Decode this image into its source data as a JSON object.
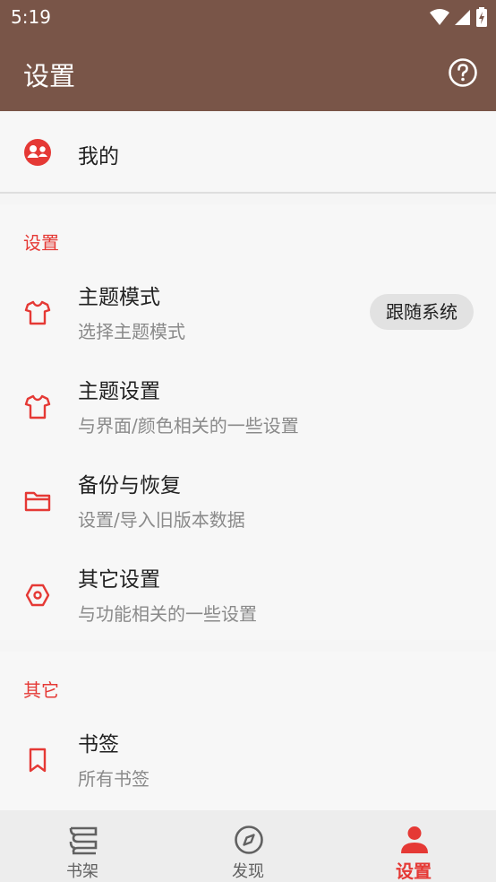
{
  "status_bar": {
    "time": "5:19"
  },
  "app_bar": {
    "title": "设置"
  },
  "me": {
    "label": "我的"
  },
  "settings_section": {
    "header": "设置",
    "items": [
      {
        "title": "主题模式",
        "summary": "选择主题模式",
        "value": "跟随系统",
        "icon": "shirt-icon"
      },
      {
        "title": "主题设置",
        "summary": "与界面/颜色相关的一些设置",
        "icon": "shirt-icon"
      },
      {
        "title": "备份与恢复",
        "summary": "设置/导入旧版本数据",
        "icon": "folder-icon"
      },
      {
        "title": "其它设置",
        "summary": "与功能相关的一些设置",
        "icon": "hexagon-settings-icon"
      }
    ]
  },
  "other_section": {
    "header": "其它",
    "items": [
      {
        "title": "书签",
        "summary": "所有书签",
        "icon": "bookmark-icon"
      }
    ]
  },
  "bottom_nav": [
    {
      "label": "书架",
      "icon": "bookshelf-icon",
      "active": false
    },
    {
      "label": "发现",
      "icon": "compass-icon",
      "active": false
    },
    {
      "label": "设置",
      "icon": "person-icon",
      "active": true
    }
  ],
  "colors": {
    "primary": "#795548",
    "accent": "#e53935",
    "background": "#f5f5f5"
  }
}
